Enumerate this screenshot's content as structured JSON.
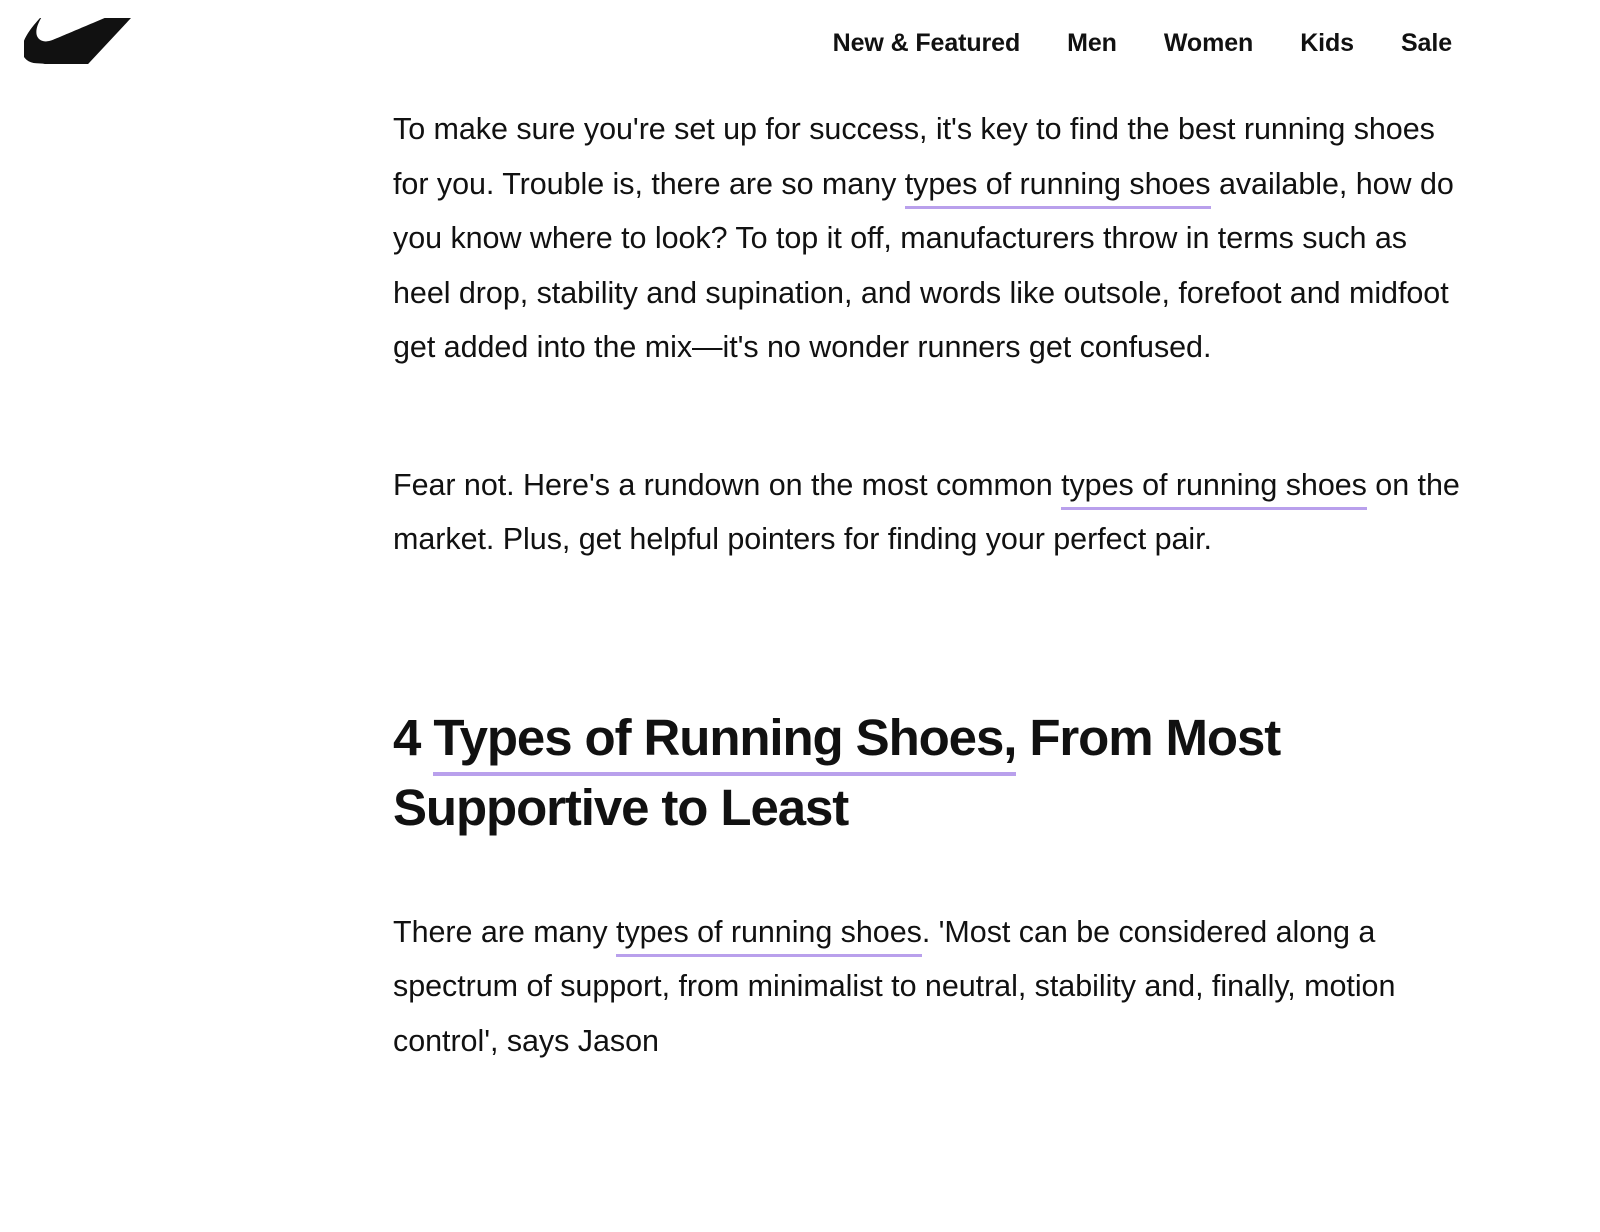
{
  "header": {
    "logo": {
      "name": "nike-swoosh-logo",
      "alt": "Nike"
    },
    "nav": [
      {
        "label": "New & Featured"
      },
      {
        "label": "Men"
      },
      {
        "label": "Women"
      },
      {
        "label": "Kids"
      },
      {
        "label": "Sale"
      }
    ]
  },
  "colors": {
    "link_underline": "#b9a0ec",
    "text": "#111111",
    "background": "#ffffff"
  },
  "article": {
    "paragraph1": {
      "part1": "To make sure you're set up for success, it's key to find the best running shoes for you. Trouble is, there are so many ",
      "link": "types of running shoes",
      "part2": " available, how do you know where to look? To top it off, manufacturers throw in terms such as heel drop, stability and supination, and words like outsole, forefoot and midfoot get added into the mix—it's no wonder runners get confused."
    },
    "paragraph2": {
      "part1": "Fear not. Here's a rundown on the most common ",
      "link": "types of running shoes",
      "part2": " on the market. Plus, get helpful pointers for finding your perfect pair."
    },
    "heading": {
      "prefix": "4 ",
      "link": "Types of Running Shoes,",
      "suffix": " From Most Supportive to Least"
    },
    "paragraph3": {
      "part1": "There are many ",
      "link": "types of running shoes",
      "part2": ". 'Most can be considered along a spectrum of support, from minimalist to neutral, stability and, finally, motion control', says Jason"
    }
  }
}
